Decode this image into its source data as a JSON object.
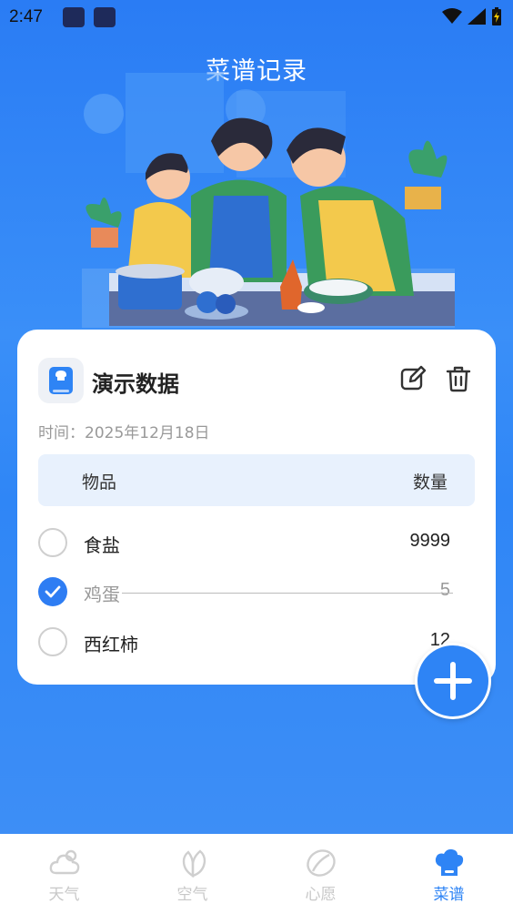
{
  "status": {
    "time": "2:47"
  },
  "header": {
    "title": "菜谱记录"
  },
  "card": {
    "title": "演示数据",
    "time": "时间：2025年12月18日",
    "columns": {
      "item": "物品",
      "qty": "数量"
    },
    "rows": [
      {
        "name": "食盐",
        "qty": "9999",
        "checked": false
      },
      {
        "name": "鸡蛋",
        "qty": "5",
        "checked": true
      },
      {
        "name": "西红柿",
        "qty": "12",
        "checked": false
      }
    ]
  },
  "nav": {
    "items": [
      {
        "label": "天气",
        "icon": "cloud-icon"
      },
      {
        "label": "空气",
        "icon": "leaf-icon"
      },
      {
        "label": "心愿",
        "icon": "wish-icon"
      },
      {
        "label": "菜谱",
        "icon": "chef-hat-icon",
        "active": true
      }
    ]
  },
  "colors": {
    "accent": "#2e84f5",
    "background": "#2f86f6",
    "header_row": "#e8f1fd"
  }
}
